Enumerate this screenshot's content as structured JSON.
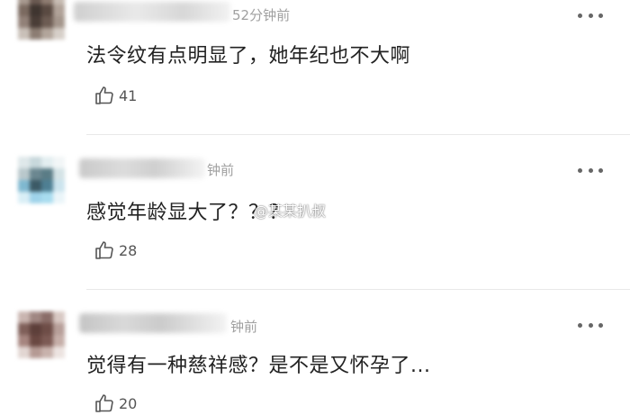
{
  "comments": [
    {
      "time": "52分钟前",
      "text": "法令纹有点明显了，她年纪也不大啊",
      "likes": "41",
      "avatar_colors": [
        "#a89a90",
        "#6b5a52",
        "#8f7d72",
        "#c7bcb3",
        "#7b6a60",
        "#3f3530",
        "#5a4a42",
        "#b0a298",
        "#928178",
        "#4a3d37",
        "#6d5c53",
        "#a4968c",
        "#c9c0b8",
        "#8c7d73",
        "#b2a59b",
        "#d6cfc8"
      ]
    },
    {
      "time": "钟前",
      "text": "感觉年龄显大了？？？",
      "likes": "28",
      "avatar_colors": [
        "#dfe8ea",
        "#c8d8dc",
        "#e3eef0",
        "#f2f6f7",
        "#b9c8cc",
        "#6b8790",
        "#5a7c86",
        "#d4e3e6",
        "#7fb8d0",
        "#3c5a66",
        "#4e7f93",
        "#cbe4ee",
        "#d9eef6",
        "#9fd3ea",
        "#a8dcef",
        "#eaf5f9"
      ]
    },
    {
      "time": "钟前",
      "text": "觉得有一种慈祥感？是不是又怀孕了...",
      "likes": "20",
      "avatar_colors": [
        "#c9b5b0",
        "#a08782",
        "#8a6d68",
        "#d8c8c3",
        "#7f5f59",
        "#5d3f3a",
        "#6e4d47",
        "#b79f99",
        "#a6857f",
        "#6a4842",
        "#7c5a54",
        "#c5aea8",
        "#e2d6d2",
        "#b59a94",
        "#c8b2ac",
        "#ece3e0"
      ]
    }
  ],
  "watermark": "@某某扒叔",
  "icons": {
    "like": "thumbs-up-icon",
    "more": "more-horizontal-icon"
  }
}
